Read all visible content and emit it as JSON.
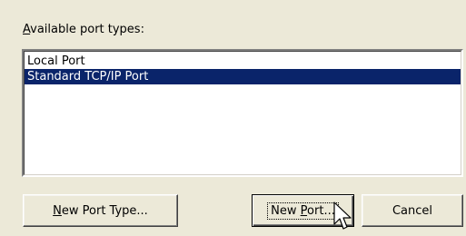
{
  "dialog": {
    "available_label_accel": "A",
    "available_label_rest": "vailable port types:",
    "port_types": [
      {
        "label": "Local Port",
        "selected": false
      },
      {
        "label": "Standard TCP/IP Port",
        "selected": true
      }
    ],
    "buttons": {
      "new_port_type": {
        "accel": "N",
        "rest": "ew Port Type..."
      },
      "new_port": {
        "pre": "New ",
        "accel": "P",
        "rest": "ort..."
      },
      "cancel": "Cancel"
    }
  },
  "colors": {
    "dialog_bg": "#ece9d8",
    "selection_bg": "#0a246a",
    "selection_fg": "#ffffff"
  },
  "icons": {
    "mouse_cursor": "arrow-pointer-icon"
  }
}
